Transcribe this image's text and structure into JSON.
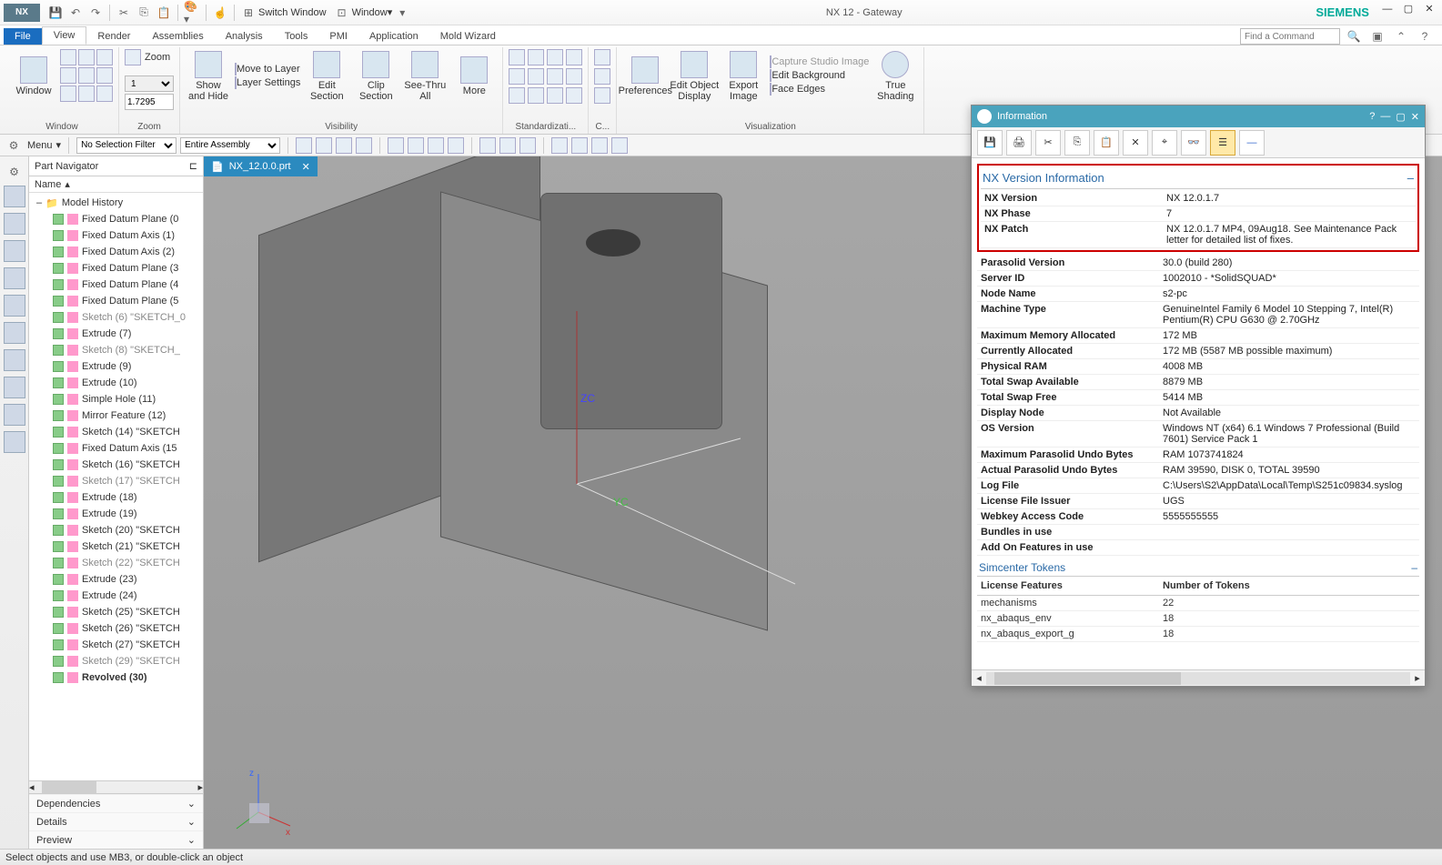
{
  "titlebar": {
    "app": "NX",
    "center": "NX 12 - Gateway",
    "brand": "SIEMENS",
    "switch_window": "Switch Window",
    "window_menu": "Window"
  },
  "ribbon_tabs": [
    "File",
    "View",
    "Render",
    "Assemblies",
    "Analysis",
    "Tools",
    "PMI",
    "Application",
    "Mold Wizard"
  ],
  "search_placeholder": "Find a Command",
  "ribbon": {
    "window_group": "Window",
    "zoom_group": "Zoom",
    "zoom_label": "Zoom",
    "zoom_value": "1.7295",
    "zoom_sel": "1",
    "visibility_group": "Visibility",
    "show_hide": "Show\nand Hide",
    "move_layer": "Move to Layer",
    "layer_settings": "Layer Settings",
    "edit_section": "Edit\nSection",
    "clip_section": "Clip\nSection",
    "see_thru": "See-Thru\nAll",
    "more": "More",
    "std_group": "Standardizati...",
    "c_group": "C...",
    "visualization_group": "Visualization",
    "preferences": "Preferences",
    "edit_object_display": "Edit Object\nDisplay",
    "export_image": "Export\nImage",
    "capture_studio": "Capture Studio Image",
    "edit_background": "Edit Background",
    "face_edges": "Face Edges",
    "true_shading": "True\nShading"
  },
  "toolbar2": {
    "menu": "Menu",
    "filter": "No Selection Filter",
    "assembly": "Entire Assembly"
  },
  "nav": {
    "title": "Part Navigator",
    "name_col": "Name",
    "history": "Model History",
    "items": [
      {
        "label": "Fixed Datum Plane (0",
        "grey": false
      },
      {
        "label": "Fixed Datum Axis (1)",
        "grey": false
      },
      {
        "label": "Fixed Datum Axis (2)",
        "grey": false
      },
      {
        "label": "Fixed Datum Plane (3",
        "grey": false
      },
      {
        "label": "Fixed Datum Plane (4",
        "grey": false
      },
      {
        "label": "Fixed Datum Plane (5",
        "grey": false
      },
      {
        "label": "Sketch (6) \"SKETCH_0",
        "grey": true
      },
      {
        "label": "Extrude (7)",
        "grey": false
      },
      {
        "label": "Sketch (8) \"SKETCH_",
        "grey": true
      },
      {
        "label": "Extrude (9)",
        "grey": false
      },
      {
        "label": "Extrude (10)",
        "grey": false
      },
      {
        "label": "Simple Hole (11)",
        "grey": false
      },
      {
        "label": "Mirror Feature (12)",
        "grey": false
      },
      {
        "label": "Sketch (14) \"SKETCH",
        "grey": false
      },
      {
        "label": "Fixed Datum Axis (15",
        "grey": false
      },
      {
        "label": "Sketch (16) \"SKETCH",
        "grey": false
      },
      {
        "label": "Sketch (17) \"SKETCH",
        "grey": true
      },
      {
        "label": "Extrude (18)",
        "grey": false
      },
      {
        "label": "Extrude (19)",
        "grey": false
      },
      {
        "label": "Sketch (20) \"SKETCH",
        "grey": false
      },
      {
        "label": "Sketch (21) \"SKETCH",
        "grey": false
      },
      {
        "label": "Sketch (22) \"SKETCH",
        "grey": true
      },
      {
        "label": "Extrude (23)",
        "grey": false
      },
      {
        "label": "Extrude (24)",
        "grey": false
      },
      {
        "label": "Sketch (25) \"SKETCH",
        "grey": false
      },
      {
        "label": "Sketch (26) \"SKETCH",
        "grey": false
      },
      {
        "label": "Sketch (27) \"SKETCH",
        "grey": false
      },
      {
        "label": "Sketch (29) \"SKETCH",
        "grey": true
      },
      {
        "label": "Revolved (30)",
        "grey": false,
        "bold": true
      }
    ],
    "foot": [
      "Dependencies",
      "Details",
      "Preview"
    ]
  },
  "doc_tab": "NX_12.0.0.prt",
  "status": "Select objects and use MB3, or double-click an object",
  "info": {
    "title": "Information",
    "section1": "NX Version Information",
    "rows1": [
      {
        "k": "NX Version",
        "v": "NX 12.0.1.7"
      },
      {
        "k": "NX Phase",
        "v": "7"
      },
      {
        "k": "NX Patch",
        "v": "NX 12.0.1.7 MP4, 09Aug18. See Maintenance Pack letter for detailed list of fixes."
      }
    ],
    "rows2": [
      {
        "k": "Parasolid Version",
        "v": "30.0 (build 280)"
      },
      {
        "k": "Server ID",
        "v": "1002010 - *SolidSQUAD*"
      },
      {
        "k": "Node Name",
        "v": "s2-pc"
      },
      {
        "k": "Machine Type",
        "v": "GenuineIntel Family 6 Model 10 Stepping 7, Intel(R) Pentium(R) CPU G630 @ 2.70GHz"
      },
      {
        "k": "Maximum Memory Allocated",
        "v": "172 MB"
      },
      {
        "k": "Currently Allocated",
        "v": "172 MB (5587 MB possible maximum)"
      },
      {
        "k": "Physical RAM",
        "v": "4008 MB"
      },
      {
        "k": "Total Swap Available",
        "v": "8879 MB"
      },
      {
        "k": "Total Swap Free",
        "v": "5414 MB"
      },
      {
        "k": "Display Node",
        "v": "Not Available"
      },
      {
        "k": "OS Version",
        "v": "Windows NT (x64) 6.1 Windows 7 Professional (Build 7601) Service Pack 1"
      },
      {
        "k": "Maximum Parasolid Undo Bytes",
        "v": "RAM 1073741824"
      },
      {
        "k": "Actual Parasolid Undo Bytes",
        "v": "RAM 39590, DISK 0, TOTAL 39590"
      },
      {
        "k": "Log File",
        "v": "C:\\Users\\S2\\AppData\\Local\\Temp\\S251c09834.syslog"
      },
      {
        "k": "License File Issuer",
        "v": "UGS"
      },
      {
        "k": "Webkey Access Code",
        "v": "5555555555"
      },
      {
        "k": "Bundles in use",
        "v": ""
      },
      {
        "k": "Add On Features in use",
        "v": ""
      }
    ],
    "section2": "Simcenter Tokens",
    "tok_head": {
      "c1": "License Features",
      "c2": "Number of Tokens"
    },
    "tokens": [
      {
        "c1": "mechanisms",
        "c2": "22"
      },
      {
        "c1": "nx_abaqus_env",
        "c2": "18"
      },
      {
        "c1": "nx_abaqus_export_g",
        "c2": "18"
      }
    ]
  }
}
